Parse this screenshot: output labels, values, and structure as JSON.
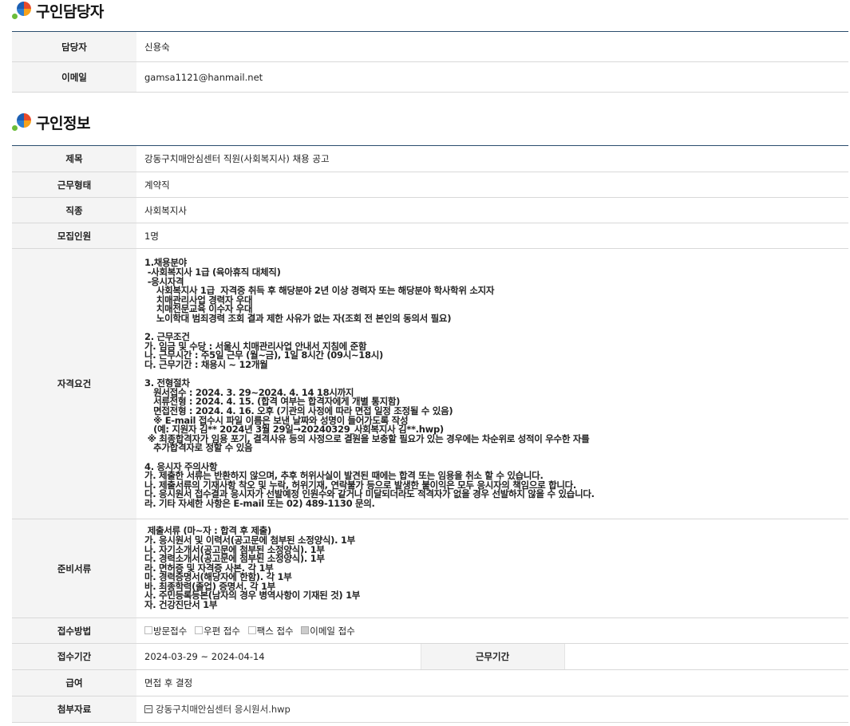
{
  "contact": {
    "title": "구인담당자",
    "rows": [
      {
        "label": "담당자",
        "value": "신용숙"
      },
      {
        "label": "이메일",
        "value": "gamsa1121@hanmail.net"
      }
    ]
  },
  "job": {
    "title": "구인정보",
    "subject_label": "제목",
    "subject": "강동구치매안심센터 직원(사회복지사) 채용 공고",
    "employment_label": "근무형태",
    "employment": "계약직",
    "jobtype_label": "직종",
    "jobtype": "사회복지사",
    "headcount_label": "모집인원",
    "headcount": "1명",
    "requirements_label": "자격요건",
    "requirements": "1.채용분야\n -사회복지사 1급 (육아휴직 대체직)\n -응시자격\n    사회복지사 1급  자격증 취득 후 해당분야 2년 이상 경력자 또는 해당분야 학사학위 소지자\n    치매관리사업 경력자 우대\n    치매전문교육 이수자 우대\n    노이학대 범죄경력 조회 결과 제한 사유가 없는 자(조회 전 본인의 동의서 필요)\n\n2. 근무조건\n가. 임금 및 수당 : 서울시 치매관리사업 안내서 지침에 준함\n나. 근무시간 : 주5일 근무 (월~금), 1일 8시간 (09시~18시)\n다. 근무기간 : 채용시 ~ 12개월\n\n3. 전형절차\n   원서접수 : 2024. 3. 29~2024. 4. 14 18시까지\n   서류전형 : 2024. 4. 15. (합격 여부는 합격자에게 개별 통지함)\n   면접전형 : 2024. 4. 16. 오후 (기관의 사정에 따라 면접 일정 조정될 수 있음)\n   ※ E-mail 접수시 파일 이름은 보낸 날짜와 성명이 들어가도록 작성\n   (예: 지원자 김** 2024년 3월 29일→20240329_사회복지사 김**.hwp)\n ※ 최종합격자가 임용 포기, 결격사유 등의 사정으로 결원을 보충할 필요가 있는 경우에는 차순위로 성적이 우수한 자를\n   추가합격자로 정할 수 있음\n\n4. 응시자 주의사항\n가. 제출한 서류는 반환하지 않으며, 추후 허위사실이 발견된 때에는 합격 또는 임용을 취소 할 수 있습니다.\n나. 제출서류의 기재사항 착오 및 누락, 허위기재, 연락불가 등으로 발생한 불이익은 모두 응시자의 책임으로 합니다.\n다. 응시원서 접수결과 응시자가 선발예정 인원수와 같거나 미달되더라도 적격자가 없을 경우 선발하지 않을 수 있습니다.\n라. 기타 자세한 사항은 E-mail 또는 02) 489-1130 문의.",
    "documents_label": "준비서류",
    "documents": " 제출서류 (마~자 : 합격 후 제출)\n가. 응시원서 및 이력서(공고문에 첨부된 소정양식). 1부\n나. 자기소개서(공고문에 첨부된 소정양식). 1부\n다. 경력소개서(공고문에 첨부된 소정양식). 1부\n라. 면허증 및 자격증 사본. 각 1부\n마. 경력증명서(해당자에 한함). 각 1부\n바. 최종학력(졸업) 증명서. 각 1부\n사. 주민등록등본(남자의 경우 병역사항이 기재된 것) 1부\n자. 건강진단서 1부",
    "method_label": "접수방법",
    "methods": [
      {
        "label": "방문접수",
        "checked": false
      },
      {
        "label": "우편 접수",
        "checked": false
      },
      {
        "label": "팩스 접수",
        "checked": false
      },
      {
        "label": "이메일 접수",
        "checked": true
      }
    ],
    "period_label": "접수기간",
    "period": "2024-03-29 ~ 2024-04-14",
    "work_period_label": "근무기간",
    "work_period": "",
    "salary_label": "급여",
    "salary": "면접 후 결정",
    "attachment_label": "첨부자료",
    "attachment": "강동구치매안심센터  응시원서.hwp"
  }
}
